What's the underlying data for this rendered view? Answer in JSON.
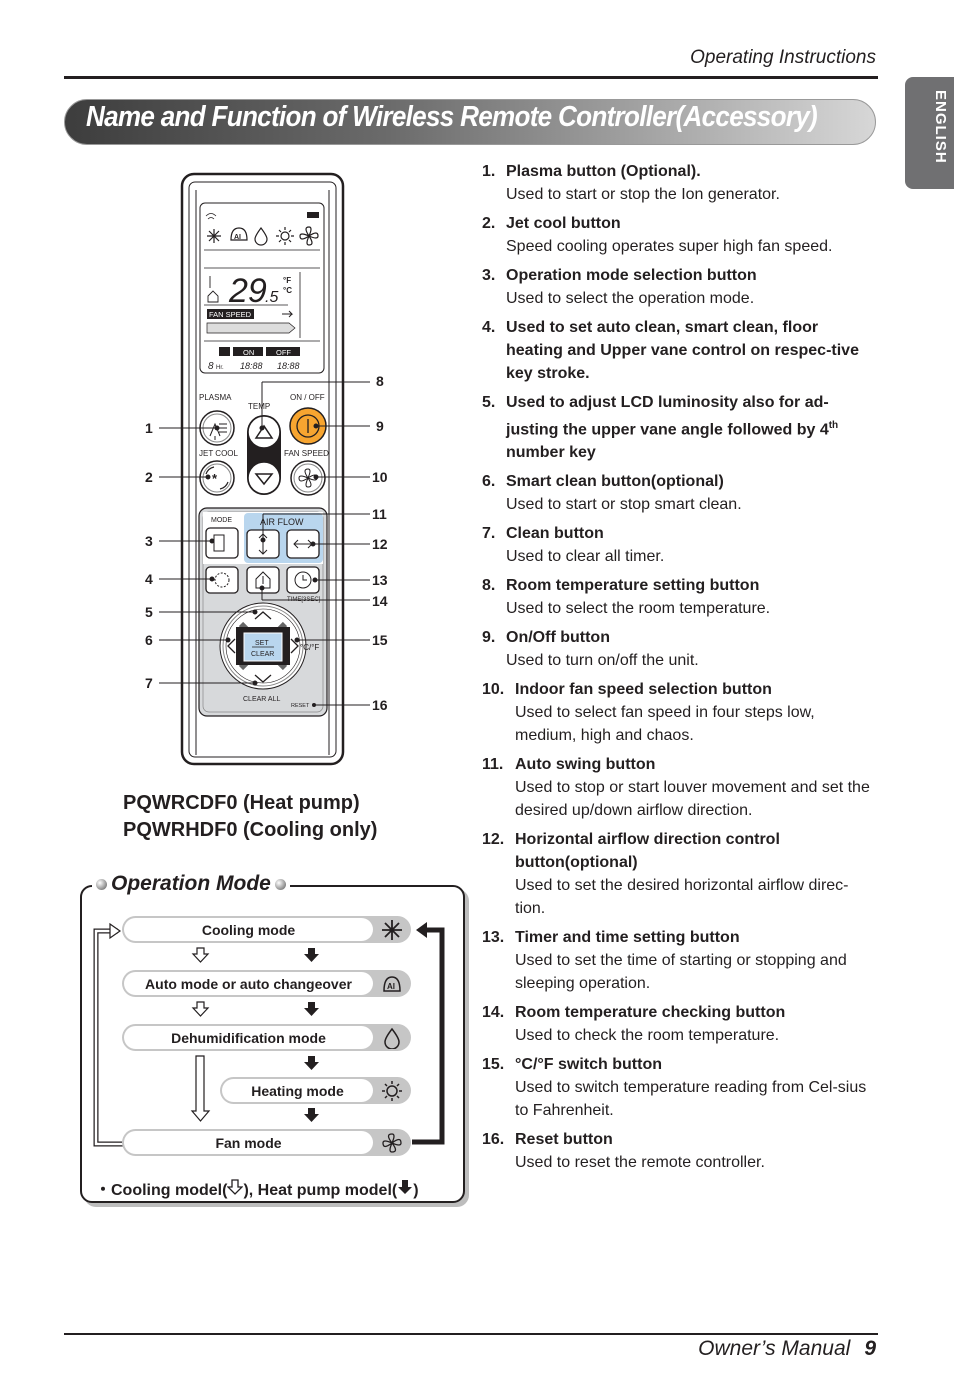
{
  "header": {
    "section": "Operating Instructions",
    "title": "Name and Function of Wireless Remote Controller(Accessory)",
    "language_tab": "ENGLISH"
  },
  "footer": {
    "manual": "Owner’s Manual",
    "page": "9"
  },
  "remote": {
    "display": {
      "temperature": "29",
      "temperature_decimal": ".5",
      "unit_f": "°F",
      "unit_c": "°C",
      "fan_speed_label": "FAN SPEED",
      "timer_on": "ON",
      "timer_off": "OFF",
      "hours": "8",
      "hours_label": "Hr.",
      "time_on": "18:88",
      "time_off": "18:88",
      "mode_icons": [
        "snowflake-icon",
        "ai-auto-icon",
        "droplet-icon",
        "sun-icon",
        "fan-icon"
      ]
    },
    "labels": {
      "plasma": "PLASMA",
      "temp": "TEMP",
      "on_off": "ON / OFF",
      "jet_cool": "JET COOL",
      "fan_speed": "FAN SPEED",
      "mode": "MODE",
      "air_flow": "AIR FLOW",
      "time": "TIME[3SEC]",
      "set": "SET",
      "clear": "CLEAR",
      "clear_all": "CLEAR ALL",
      "reset": "RESET",
      "cf": "°C/°F"
    },
    "callouts": [
      "1",
      "2",
      "3",
      "4",
      "5",
      "6",
      "7",
      "8",
      "9",
      "10",
      "11",
      "12",
      "13",
      "14",
      "15",
      "16"
    ],
    "accent_on_off": "#f7a530",
    "accent_panel": "#b9d6ee"
  },
  "models": {
    "line1": "PQWRCDF0 (Heat pump)",
    "line2": "PQWRHDF0 (Cooling only)"
  },
  "operation_mode": {
    "title": "Operation Mode",
    "modes": [
      {
        "label": "Cooling mode",
        "icon": "snowflake-icon"
      },
      {
        "label": "Auto mode or auto changeover",
        "icon": "ai-auto-icon"
      },
      {
        "label": "Dehumidification mode",
        "icon": "droplet-icon"
      },
      {
        "label": "Heating mode",
        "icon": "sun-icon"
      },
      {
        "label": "Fan mode",
        "icon": "fan-icon"
      }
    ],
    "legend_prefix": "・Cooling model(",
    "legend_mid": "), Heat pump model(",
    "legend_suffix": ")"
  },
  "functions": [
    {
      "num": "1.",
      "title": "Plasma button (Optional).",
      "desc": "Used to start or stop the Ion generator."
    },
    {
      "num": "2.",
      "title": "Jet cool button",
      "desc": "Speed cooling operates super high fan speed."
    },
    {
      "num": "3.",
      "title": "Operation mode selection button",
      "desc": "Used to select the operation mode."
    },
    {
      "num": "4.",
      "title": "Used to set auto clean, smart clean, floor heating and Upper vane control on respec-tive key stroke.",
      "desc": ""
    },
    {
      "num": "5.",
      "title": "Used to adjust LCD luminosity also for ad-justing the upper vane angle followed by 4",
      "title_sup": "th",
      "title_after": " number key",
      "desc": ""
    },
    {
      "num": "6.",
      "title": "Smart clean button(optional)",
      "desc": "Used to start or stop smart clean."
    },
    {
      "num": "7.",
      "title": "Clean button",
      "desc": "Used to clear all timer."
    },
    {
      "num": "8.",
      "title": "Room temperature setting button",
      "desc": "Used to select the room temperature."
    },
    {
      "num": "9.",
      "title": "On/Off button",
      "desc": "Used to turn on/off the unit."
    },
    {
      "num": "10.",
      "title": "Indoor fan speed selection button",
      "desc": "Used to select fan speed in four steps low, medium, high and chaos."
    },
    {
      "num": "11.",
      "title": "Auto swing button",
      "desc": "Used to stop or start louver movement and set the desired up/down airflow direction."
    },
    {
      "num": "12.",
      "title": "Horizontal airflow direction control button(optional)",
      "desc": "Used to set the desired horizontal airflow direc-tion."
    },
    {
      "num": "13.",
      "title": "Timer and time setting button",
      "desc": "Used to set the time of starting or stopping and sleeping operation."
    },
    {
      "num": "14.",
      "title": "Room temperature checking button",
      "desc": "Used to check the room temperature."
    },
    {
      "num": "15.",
      "title": "°C/°F switch button",
      "desc": "Used to switch temperature reading from Cel-sius to Fahrenheit."
    },
    {
      "num": "16.",
      "title": "Reset button",
      "desc": "Used to reset the remote controller."
    }
  ]
}
